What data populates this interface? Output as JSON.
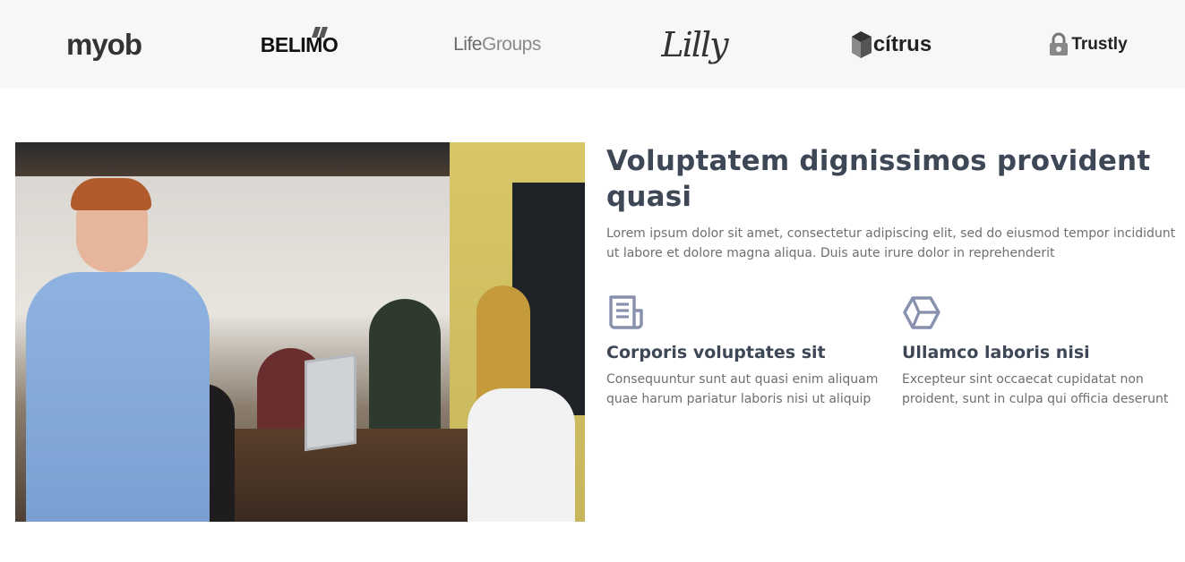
{
  "clients": {
    "logos": [
      {
        "name": "myob",
        "text": "myob"
      },
      {
        "name": "belimo",
        "text": "BELIMO"
      },
      {
        "name": "lifegroups",
        "text_part1": "Life",
        "text_part2": "Groups"
      },
      {
        "name": "lilly",
        "text": "Lilly"
      },
      {
        "name": "citrus",
        "text": "cítrus"
      },
      {
        "name": "trustly",
        "text": "Trustly"
      }
    ]
  },
  "about": {
    "heading": "Voluptatem dignissimos provident quasi",
    "lead": "Lorem ipsum dolor sit amet, consectetur adipiscing elit, sed do eiusmod tempor incididunt ut labore et dolore magna aliqua. Duis aute irure dolor in reprehenderit",
    "features": [
      {
        "icon": "newspaper-icon",
        "title": "Corporis voluptates sit",
        "text": "Consequuntur sunt aut quasi enim aliquam quae harum pariatur laboris nisi ut aliquip"
      },
      {
        "icon": "hexagon-icon",
        "title": "Ullamco laboris nisi",
        "text": "Excepteur sint occaecat cupidatat non proident, sunt in culpa qui officia deserunt"
      }
    ]
  },
  "colors": {
    "heading": "#3e4756",
    "body_text": "#6f6f6f",
    "icon": "#8790ac",
    "logo_bar_bg": "#f6f7f9"
  }
}
